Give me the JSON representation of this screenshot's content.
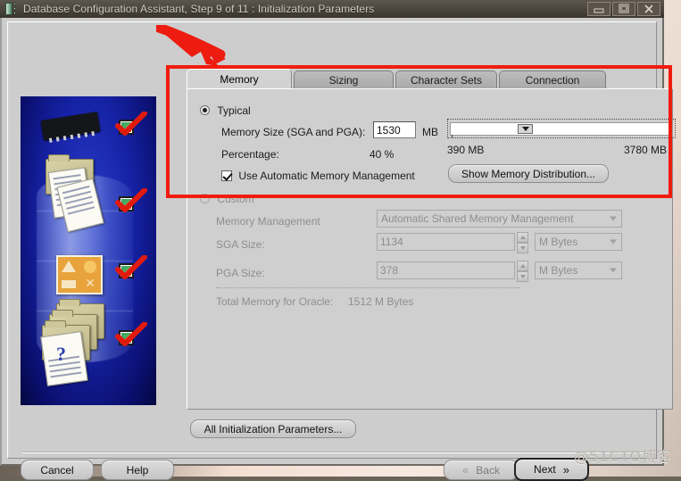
{
  "window": {
    "title": "Database Configuration Assistant, Step 9 of 11 : Initialization Parameters",
    "icon": "database-icon",
    "buttons": {
      "minimize": "minimize-icon",
      "maximize": "maximize-icon",
      "close": "close-icon"
    }
  },
  "tabs": [
    {
      "label": "Memory",
      "active": true
    },
    {
      "label": "Sizing",
      "active": false
    },
    {
      "label": "Character Sets",
      "active": false
    },
    {
      "label": "Connection Mode",
      "active": false
    }
  ],
  "typical": {
    "radio_label": "Typical",
    "selected": true,
    "memory_size_label": "Memory Size (SGA and PGA):",
    "memory_size_value": "1530",
    "memory_size_unit": "MB",
    "percentage_label": "Percentage:",
    "percentage_value": "40 %",
    "amm_checkbox_label": "Use Automatic Memory Management",
    "amm_checked": true,
    "slider_min_label": "390 MB",
    "slider_max_label": "3780 MB",
    "slider_min": 390,
    "slider_max": 3780,
    "slider_value": 1530,
    "show_memory_distribution_label": "Show Memory Distribution..."
  },
  "custom": {
    "radio_label": "Custom",
    "selected": false,
    "memory_management_label": "Memory Management",
    "memory_management_value": "Automatic Shared Memory Management",
    "sga_label": "SGA Size:",
    "sga_value": "1134",
    "sga_unit": "M Bytes",
    "pga_label": "PGA Size:",
    "pga_value": "378",
    "pga_unit": "M Bytes",
    "total_label": "Total Memory for Oracle:",
    "total_value": "1512 M Bytes"
  },
  "footer": {
    "all_params_label": "All Initialization Parameters...",
    "cancel_label": "Cancel",
    "help_label": "Help",
    "back_label": "Back",
    "next_label": "Next",
    "back_icon": "chevron-double-left-icon",
    "next_icon": "chevron-double-right-icon"
  },
  "annotations": {
    "box_color": "#f01c0e",
    "arrow_color": "#ee1c10",
    "arrow_target": "Memory tab"
  },
  "watermark": "@51CTO博客",
  "side_art": {
    "checkmark_count": 4,
    "alt": "database-illustration"
  }
}
